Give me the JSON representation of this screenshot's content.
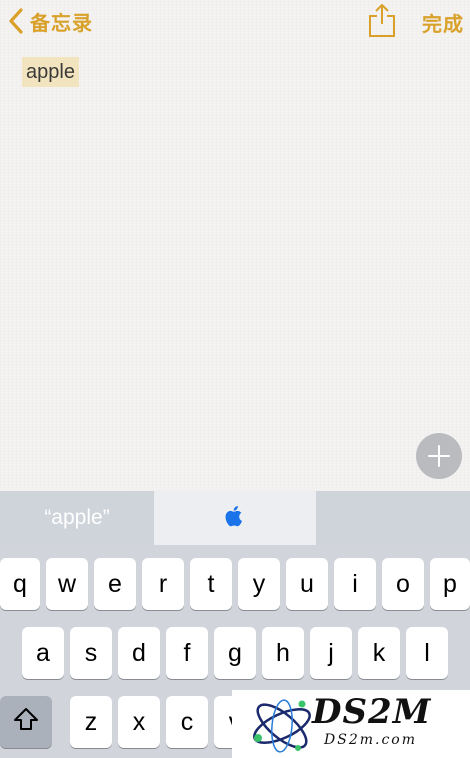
{
  "colors": {
    "accent": "#d9a12a",
    "highlight": "#f1e4bf",
    "keyboard_bg": "#d1d5db"
  },
  "nav": {
    "back_label": "备忘录",
    "back_icon": "chevron-left-icon",
    "share_icon": "share-icon",
    "done_label": "完成"
  },
  "note": {
    "text": "apple"
  },
  "add_button_icon": "plus-icon",
  "suggestions": [
    {
      "label": "“apple”"
    },
    {
      "label": "",
      "icon": "apple-logo-icon"
    },
    {
      "label": ""
    }
  ],
  "keyboard": {
    "row1": [
      "q",
      "w",
      "e",
      "r",
      "t",
      "y",
      "u",
      "i",
      "o",
      "p"
    ],
    "row2": [
      "a",
      "s",
      "d",
      "f",
      "g",
      "h",
      "j",
      "k",
      "l"
    ],
    "row3": [
      "z",
      "x",
      "c",
      "v"
    ],
    "shift_icon": "shift-arrow-icon"
  },
  "watermark": {
    "title": "DS2M",
    "subtitle": "DS2m.com"
  }
}
